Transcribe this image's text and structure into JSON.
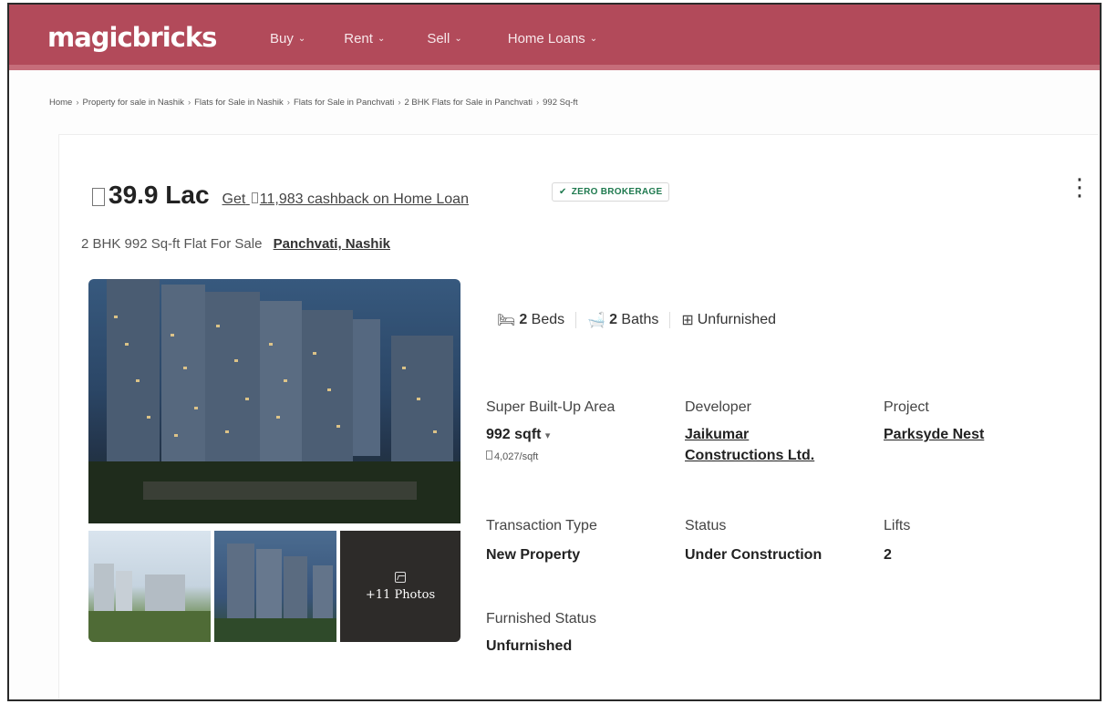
{
  "header": {
    "logo": "magicbricks",
    "nav": [
      {
        "label": "Buy"
      },
      {
        "label": "Rent"
      },
      {
        "label": "Sell"
      },
      {
        "label": "Home Loans"
      }
    ]
  },
  "breadcrumb": [
    "Home",
    "Property for sale in Nashik",
    "Flats for Sale in Nashik",
    "Flats for Sale in Panchvati",
    "2 BHK Flats for Sale in Panchvati",
    "992 Sq-ft"
  ],
  "listing": {
    "price": "39.9 Lac",
    "cashback": "Get 11,983 cashback on Home Loan",
    "cashback_prefix": "Get",
    "cashback_rest": "11,983 cashback on Home Loan",
    "badge": "ZERO BROKERAGE",
    "title": "2 BHK 992 Sq-ft Flat For Sale",
    "location": "Panchvati, Nashik",
    "more_photos": "+11 Photos",
    "beds_num": "2",
    "beds_label": "Beds",
    "baths_num": "2",
    "baths_label": "Baths",
    "furnishing": "Unfurnished"
  },
  "details": {
    "area_label": "Super Built-Up Area",
    "area_value": "992 sqft",
    "price_per_sqft": "4,027/sqft",
    "developer_label": "Developer",
    "developer_line1": "Jaikumar",
    "developer_line2": "Constructions Ltd.",
    "project_label": "Project",
    "project_value": "Parksyde Nest",
    "transaction_label": "Transaction Type",
    "transaction_value": "New Property",
    "status_label": "Status",
    "status_value": "Under Construction",
    "lifts_label": "Lifts",
    "lifts_value": "2",
    "furnished_label": "Furnished Status",
    "furnished_value": "Unfurnished"
  },
  "colors": {
    "header_bg": "#b24a5a",
    "badge_green": "#1f7a4f"
  }
}
